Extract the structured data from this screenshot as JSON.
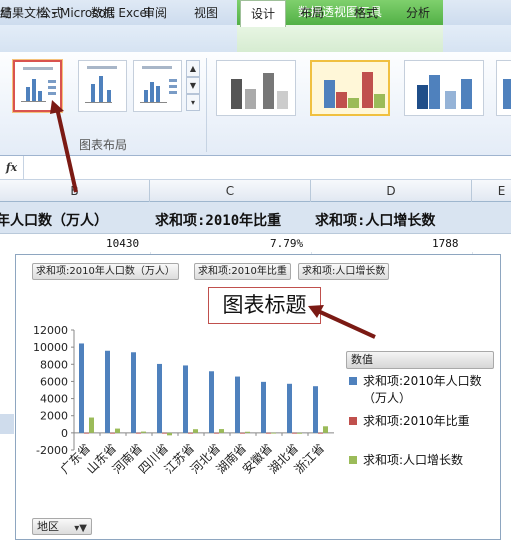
{
  "window": {
    "title": "结果文档 - Microsoft Excel",
    "context_title": "数据透视图工具"
  },
  "tabs": [
    {
      "label": "局",
      "active": false
    },
    {
      "label": "公式",
      "active": false
    },
    {
      "label": "数据",
      "active": false
    },
    {
      "label": "审阅",
      "active": false
    },
    {
      "label": "视图",
      "active": false
    },
    {
      "label": "设计",
      "active": true
    },
    {
      "label": "布局",
      "active": false
    },
    {
      "label": "格式",
      "active": false
    },
    {
      "label": "分析",
      "active": false
    }
  ],
  "ribbon": {
    "group_label": "图表布局",
    "scroll_up": "▲",
    "scroll_down": "▼",
    "scroll_more": "▾"
  },
  "formula_bar": {
    "fx": "fx"
  },
  "columns": [
    "B",
    "C",
    "D",
    "E"
  ],
  "header_row": [
    "年人口数（万人）",
    "求和项:2010年比重",
    "求和项:人口增长数"
  ],
  "value_row": [
    "10430",
    "7.79%",
    "1788"
  ],
  "chart": {
    "field_buttons": [
      "求和项:2010年人口数（万人）",
      "求和项:2010年比重",
      "求和项:人口增长数"
    ],
    "title": "图表标题",
    "legend_header": "数值",
    "region_button": "地区",
    "filter_icon": "▾▼"
  },
  "colors": {
    "series1": "#4f81bd",
    "series2": "#c0504d",
    "series3": "#9bbb59",
    "selection": "#d9534f",
    "arrow": "#7b1a14"
  },
  "chart_data": {
    "type": "bar",
    "categories": [
      "广东省",
      "山东省",
      "河南省",
      "四川省",
      "江苏省",
      "河北省",
      "湖南省",
      "安徽省",
      "湖北省",
      "浙江省"
    ],
    "series": [
      {
        "name": "求和项:2010年人口数（万人）",
        "values": [
          10430,
          9579,
          9402,
          8042,
          7866,
          7185,
          6568,
          5950,
          5724,
          5443
        ]
      },
      {
        "name": "求和项:2010年比重",
        "values": [
          7.79,
          7.15,
          7.02,
          6.0,
          5.87,
          5.36,
          4.9,
          4.44,
          4.27,
          4.06
        ]
      },
      {
        "name": "求和项:人口增长数",
        "values": [
          1788,
          500,
          150,
          -293,
          426,
          441,
          128,
          10,
          -104,
          766
        ]
      }
    ],
    "yticks": [
      "12000",
      "10000",
      "8000",
      "6000",
      "4000",
      "2000",
      "0",
      "-2000"
    ],
    "ylim": [
      -2000,
      12000
    ],
    "grid": false,
    "legend": "right"
  }
}
